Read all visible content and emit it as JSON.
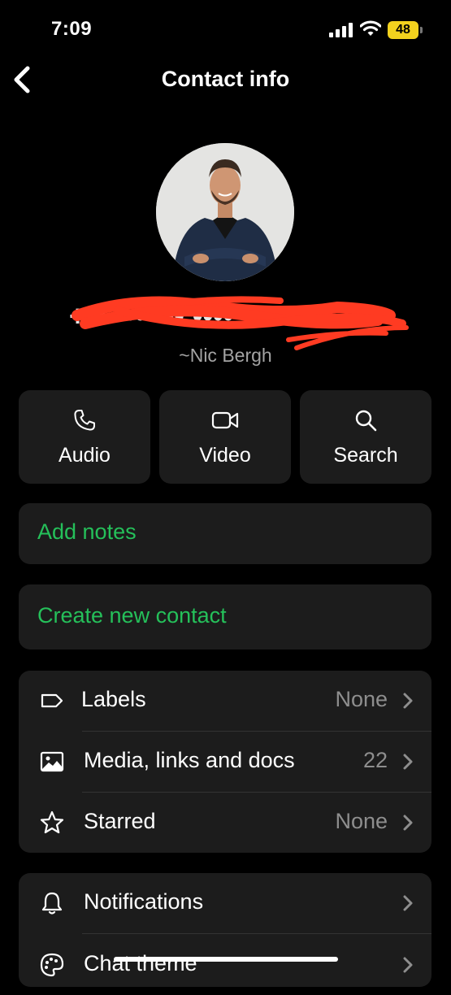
{
  "status_bar": {
    "time": "7:09",
    "battery": "48"
  },
  "nav": {
    "title": "Contact info"
  },
  "contact": {
    "phone": "+•• ••• ••• ••••",
    "name": "~Nic Bergh"
  },
  "actions": [
    {
      "label": "Audio",
      "icon": "phone-icon"
    },
    {
      "label": "Video",
      "icon": "video-icon"
    },
    {
      "label": "Search",
      "icon": "search-icon"
    }
  ],
  "add_notes": "Add notes",
  "create_contact": "Create new contact",
  "details": [
    {
      "label": "Labels",
      "value": "None",
      "icon": "label-icon"
    },
    {
      "label": "Media, links and docs",
      "value": "22",
      "icon": "image-icon"
    },
    {
      "label": "Starred",
      "value": "None",
      "icon": "star-icon"
    }
  ],
  "settings": [
    {
      "label": "Notifications",
      "icon": "bell-icon"
    },
    {
      "label": "Chat theme",
      "icon": "palette-icon"
    }
  ],
  "colors": {
    "accent": "#25c05a",
    "card": "#1c1c1c",
    "background": "#000000",
    "redaction": "#ff3b22"
  }
}
